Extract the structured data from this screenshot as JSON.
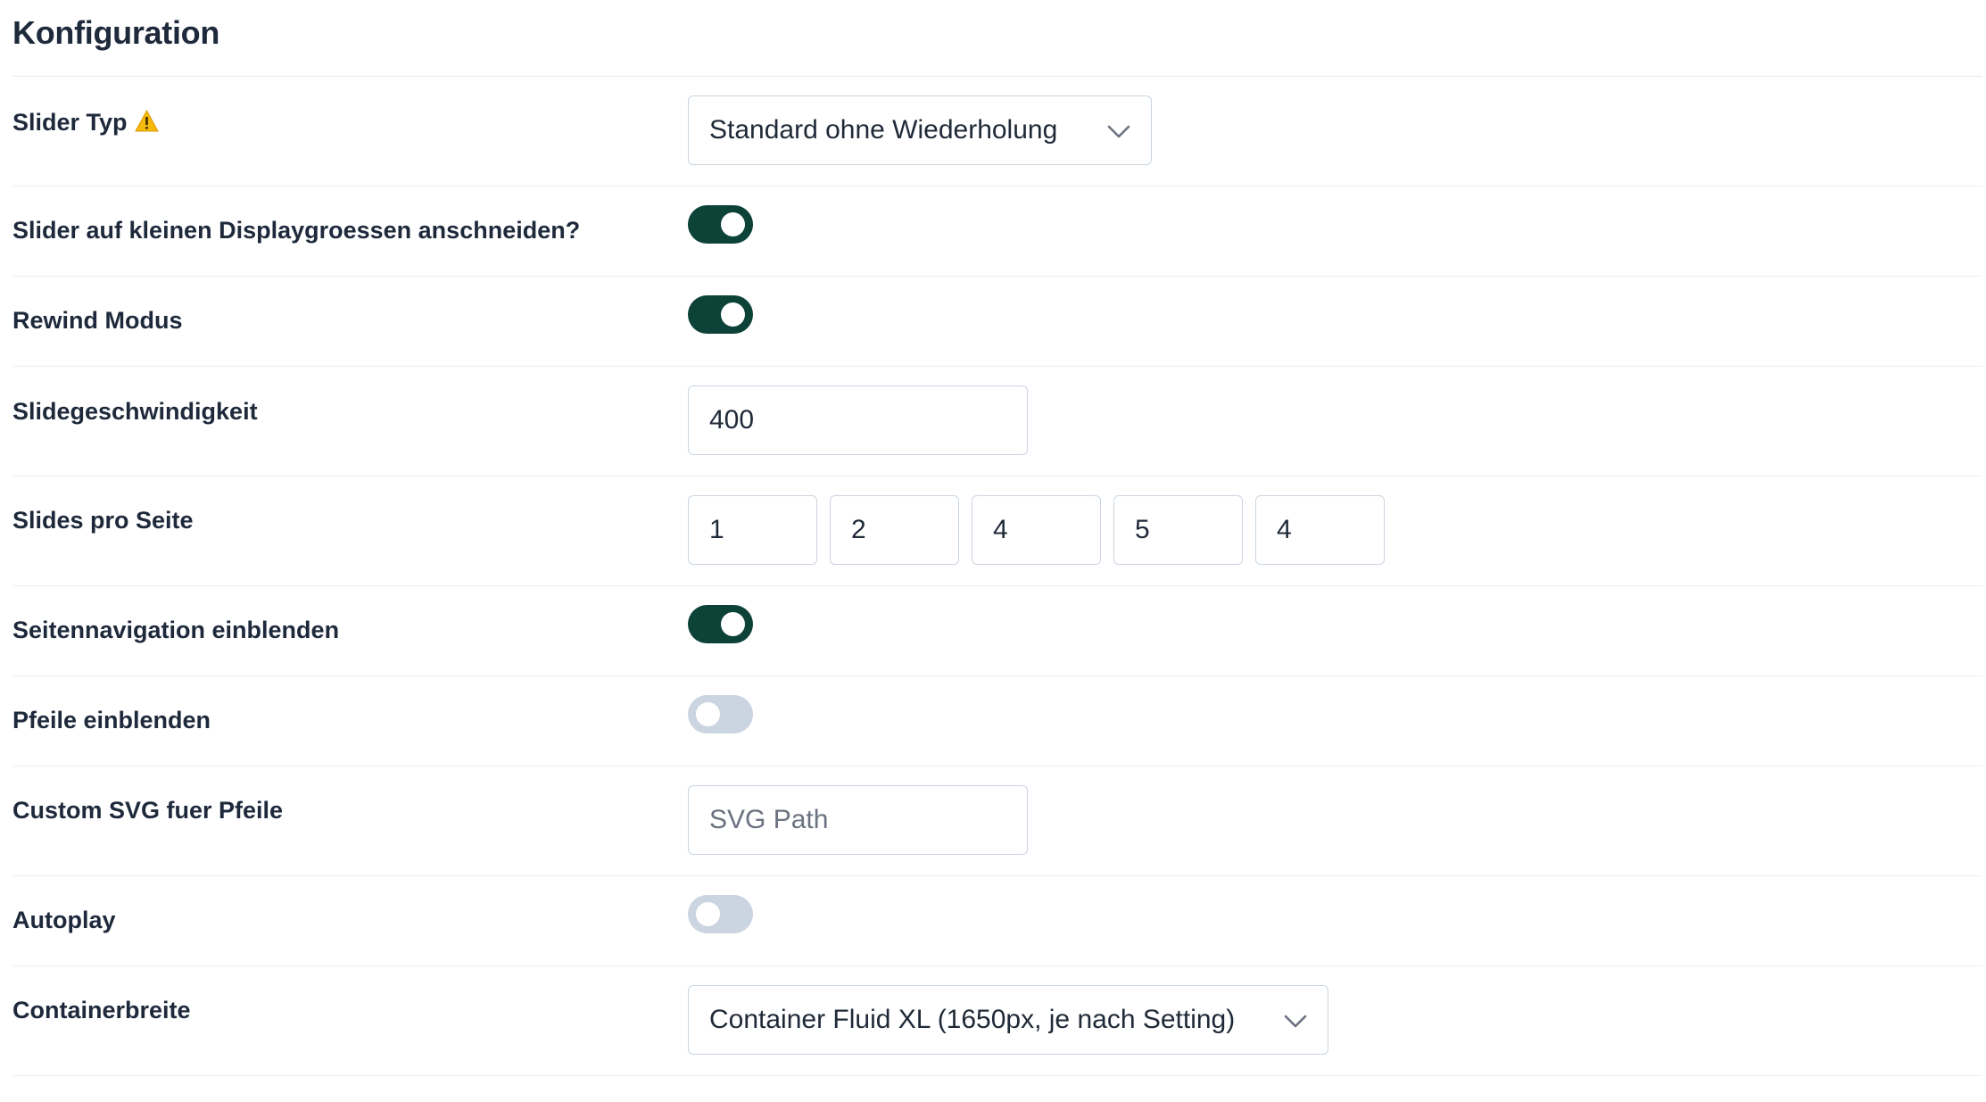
{
  "section": {
    "title": "Konfiguration"
  },
  "fields": {
    "slider_typ": {
      "label": "Slider Typ",
      "warning_icon": "warning-triangle-icon",
      "value": "Standard ohne Wiederholung"
    },
    "anschneiden": {
      "label": "Slider auf kleinen Displaygroessen anschneiden?",
      "checked": true
    },
    "rewind": {
      "label": "Rewind Modus",
      "checked": true
    },
    "geschwindigkeit": {
      "label": "Slidegeschwindigkeit",
      "value": "400"
    },
    "slides_pro_seite": {
      "label": "Slides pro Seite",
      "values": [
        "1",
        "2",
        "4",
        "5",
        "4"
      ]
    },
    "seitennavigation": {
      "label": "Seitennavigation einblenden",
      "checked": true
    },
    "pfeile": {
      "label": "Pfeile einblenden",
      "checked": false
    },
    "custom_svg": {
      "label": "Custom SVG fuer Pfeile",
      "value": "",
      "placeholder": "SVG Path"
    },
    "autoplay": {
      "label": "Autoplay",
      "checked": false
    },
    "containerbreite": {
      "label": "Containerbreite",
      "value": "Container Fluid XL (1650px, je nach Setting)"
    }
  },
  "colors": {
    "toggle_on": "#0d4239",
    "toggle_off": "#cbd5e1",
    "warning": "#f5b90a"
  }
}
